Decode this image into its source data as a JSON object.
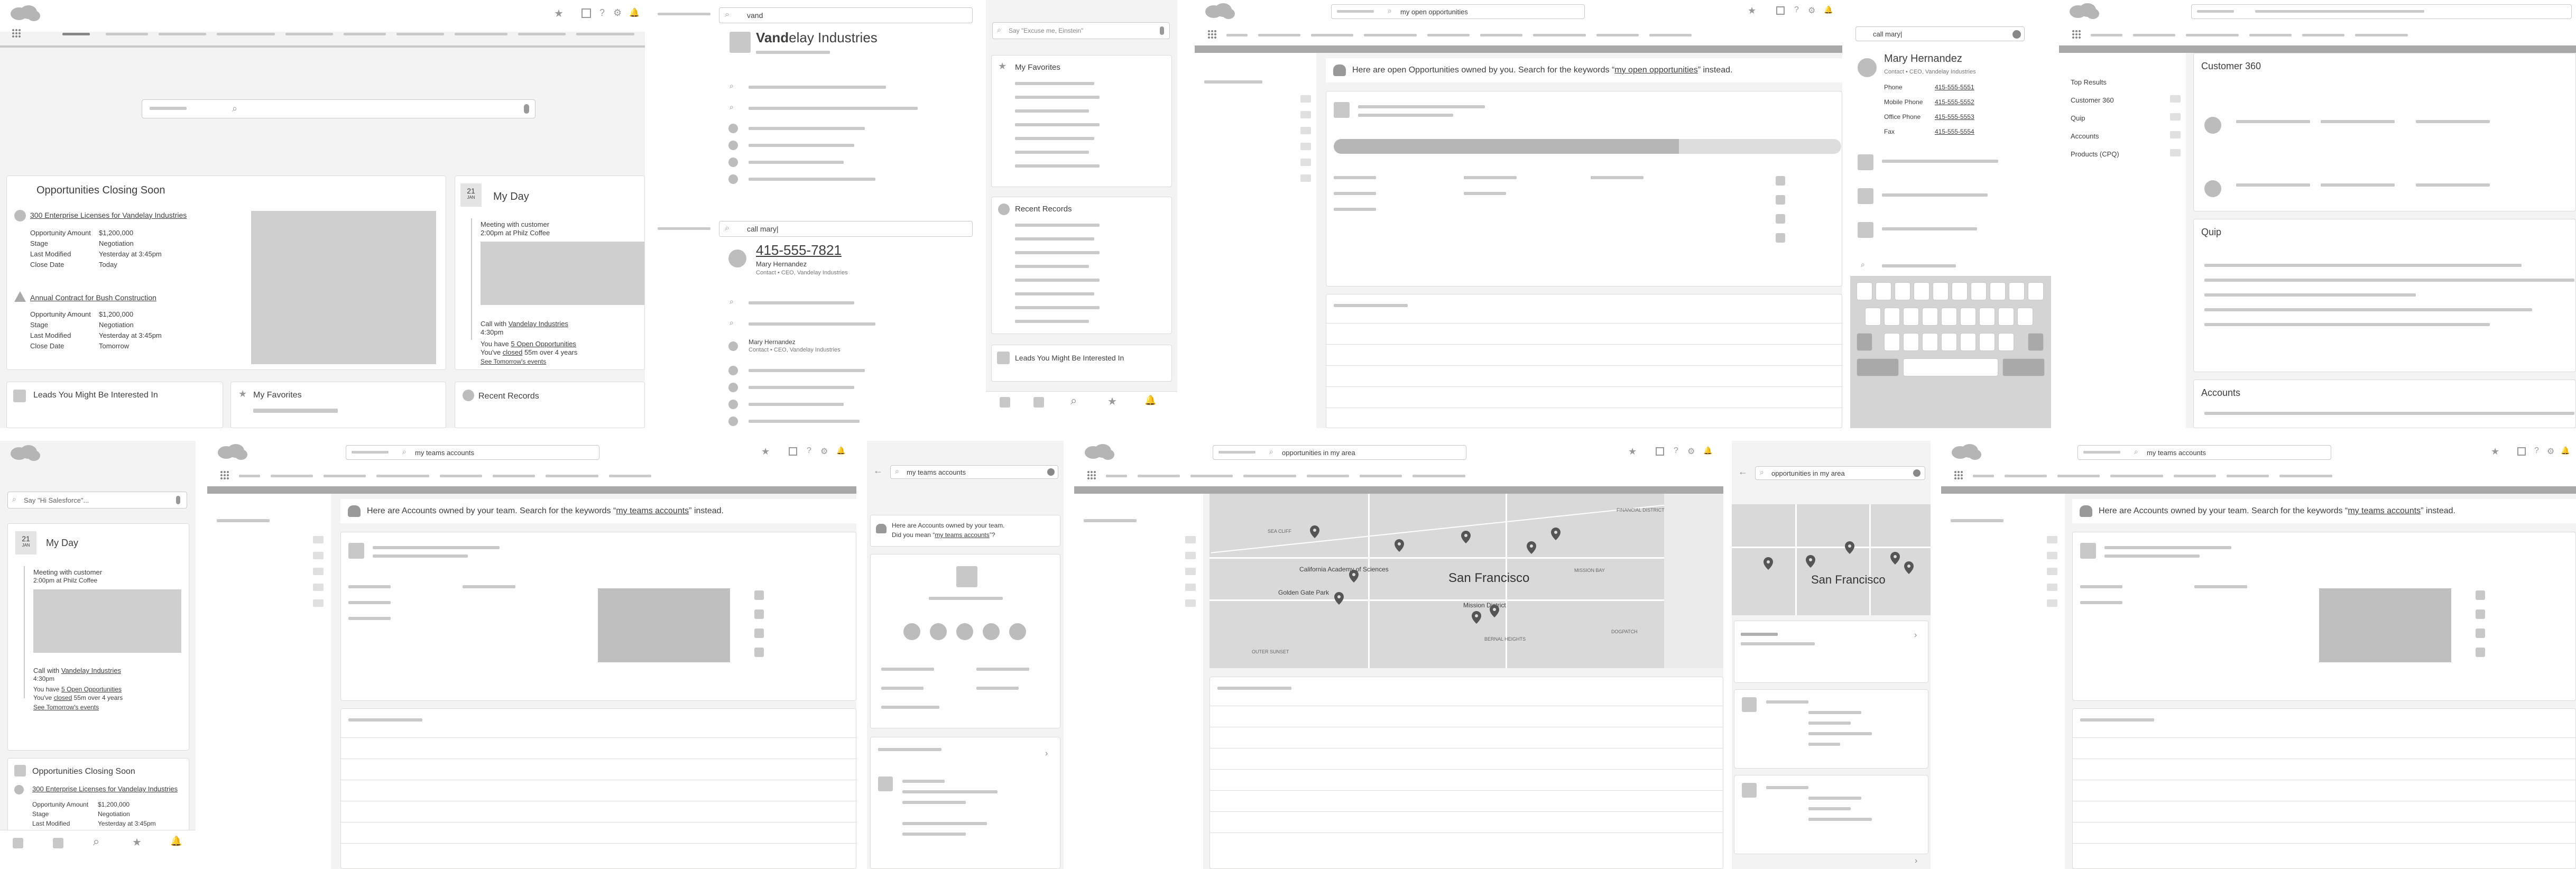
{
  "search_hints": {
    "p2_query": "vand",
    "p2_result_title_bold": "Vand",
    "p2_result_title_rest": "elay Industries",
    "p2_query2": "call mary|",
    "p3_placeholder": "Say \"Excuse me, Einstein\"",
    "p5_query": "my open opportunities",
    "p6_query": "call mary|",
    "p8_placeholder": "Say \"Hi Salesforce\"...",
    "p9_query": "my teams accounts",
    "p10_query": "my teams accounts",
    "p11_query": "opportunities in my area",
    "p12_query": "opportunities in my area",
    "p13_query": "my teams accounts"
  },
  "opportunities_card": {
    "title": "Opportunities Closing Soon",
    "item1": {
      "link": "300 Enterprise Licenses for Vandelay Industries",
      "amount_label": "Opportunity Amount",
      "amount": "$1,200,000",
      "stage_label": "Stage",
      "stage": "Negotiation",
      "modified_label": "Last Modified",
      "modified": "Yesterday at 3:45pm",
      "close_label": "Close Date",
      "close": "Today"
    },
    "item2": {
      "link": "Annual Contract for Bush Construction",
      "amount_label": "Opportunity Amount",
      "amount": "$1,200,000",
      "stage_label": "Stage",
      "stage": "Negotiation",
      "modified_label": "Last Modified",
      "modified": "Yesterday at 3:45pm",
      "close_label": "Close Date",
      "close": "Tomorrow"
    }
  },
  "myday_card": {
    "date_num": "21",
    "date_month": "JAN",
    "title": "My Day",
    "event1_title": "Meeting with customer",
    "event1_time": "2:00pm at Philz Coffee",
    "event2_title_prefix": "Call with ",
    "event2_link": "Vandelay Industries",
    "event2_time": "4:30pm",
    "note_prefix": "You have ",
    "note_link": "5 Open Opportunities",
    "note2_prefix": "You've ",
    "note2_link": "closed",
    "note2_rest": " 55m over 4 years",
    "tomorrow_link": "See Tomorrow's events"
  },
  "leads_card_title": "Leads You Might Be Interested In",
  "favorites_title": "My Favorites",
  "recent_records_title": "Recent Records",
  "phone_result": {
    "phone_number": "415-555-7821",
    "name": "Mary Hernandez",
    "sub": "Contact • CEO, Vandelay Industries",
    "list_name": "Mary Hernandez",
    "list_sub": "Contact • CEO, Vandelay Industries"
  },
  "contact_card": {
    "name": "Mary Hernandez",
    "sub": "Contact • CEO, Vandelay Industries",
    "phone_label": "Phone",
    "phone": "415-555-5551",
    "mobile_label": "Mobile Phone",
    "mobile": "415-555-5552",
    "office_label": "Office Phone",
    "office": "415-555-5553",
    "fax_label": "Fax",
    "fax": "415-555-5554"
  },
  "banner_opportunities": "Here are open Opportunities owned by you. Search for the keywords “",
  "banner_opportunities_link": "my open opportunities",
  "banner_opportunities_end": "” instead.",
  "banner_accounts": "Here are Accounts owned by your team. Search for the keywords “",
  "banner_accounts_link": "my teams accounts",
  "banner_accounts_end": "” instead.",
  "mobile_banner_line1": "Here are Accounts owned by your team.",
  "mobile_banner_line2_prefix": "Did you mean “",
  "mobile_banner_link": "my teams accounts",
  "mobile_banner_line2_end": "”?",
  "top_results_nav": {
    "items": [
      "Top Results",
      "Customer 360",
      "Quip",
      "Accounts",
      "Products (CPQ)"
    ]
  },
  "section_titles": {
    "customer360": "Customer 360",
    "quip": "Quip",
    "accounts": "Accounts"
  },
  "map_labels": {
    "sf_big": "San Francisco",
    "sf_small": "San Francisco",
    "academy": "California Academy of Sciences",
    "golden_gate": "Golden Gate Park",
    "mission": "Mission District",
    "sea_cliff": "SEA CLIFF",
    "financial": "FINANCIAL DISTRICT",
    "outer_sunset": "OUTER SUNSET",
    "mission_bay": "MISSION BAY",
    "dogpatch": "DOGPATCH",
    "bernal": "BERNAL HEIGHTS"
  }
}
